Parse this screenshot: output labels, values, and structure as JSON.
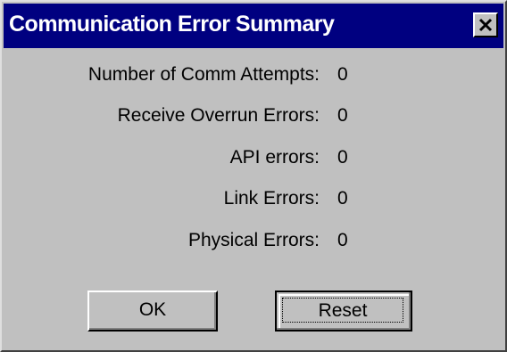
{
  "dialog": {
    "title": "Communication Error Summary",
    "close_icon": "close-icon"
  },
  "stats": [
    {
      "label": "Number of Comm Attempts:",
      "value": "0"
    },
    {
      "label": "Receive Overrun Errors:",
      "value": "0"
    },
    {
      "label": "API errors:",
      "value": "0"
    },
    {
      "label": "Link Errors:",
      "value": "0"
    },
    {
      "label": "Physical Errors:",
      "value": "0"
    }
  ],
  "buttons": {
    "ok_label": "OK",
    "reset_label": "Reset"
  },
  "colors": {
    "titlebar": "#000080",
    "face": "#c0c0c0"
  }
}
